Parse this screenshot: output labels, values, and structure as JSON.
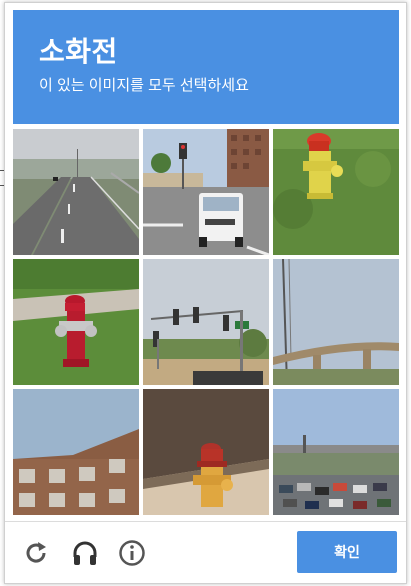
{
  "header": {
    "title": "소화전",
    "instruction": "이 있는 이미지를 모두 선택하세요"
  },
  "tiles": [
    {
      "name": "highway-road"
    },
    {
      "name": "intersection-truck"
    },
    {
      "name": "yellow-fire-hydrant"
    },
    {
      "name": "red-fire-hydrant"
    },
    {
      "name": "traffic-lights"
    },
    {
      "name": "overpass-bridge"
    },
    {
      "name": "apartment-building"
    },
    {
      "name": "red-yellow-hydrant"
    },
    {
      "name": "parking-lot"
    }
  ],
  "footer": {
    "verify_label": "확인",
    "icons": [
      "reload-icon",
      "audio-icon",
      "info-icon"
    ]
  },
  "colors": {
    "accent": "#4a90e2",
    "icon": "#555555"
  }
}
